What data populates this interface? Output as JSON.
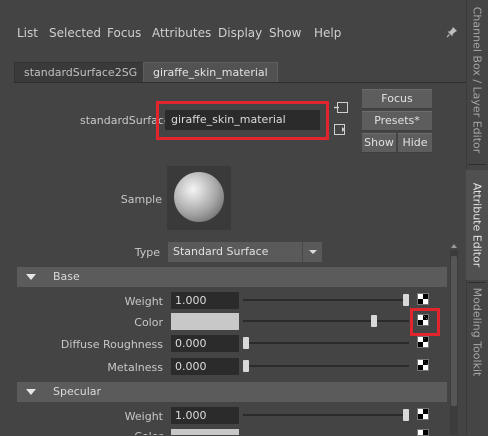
{
  "menu": {
    "items": [
      "List",
      "Selected",
      "Focus",
      "Attributes",
      "Display",
      "Show",
      "Help"
    ]
  },
  "tabs": [
    "standardSurface2SG",
    "giraffe_skin_material"
  ],
  "node": {
    "type_label": "standardSurface:",
    "name": "giraffe_skin_material"
  },
  "buttons": {
    "focus": "Focus",
    "presets": "Presets*",
    "show": "Show",
    "hide": "Hide"
  },
  "sample_label": "Sample",
  "type": {
    "label": "Type",
    "value": "Standard Surface"
  },
  "sections": {
    "base": {
      "title": "Base",
      "weight": {
        "label": "Weight",
        "value": "1.000",
        "slider": 1.0
      },
      "color": {
        "label": "Color",
        "swatch": "#c8c8c8",
        "slider": 0.8
      },
      "diffuse_roughness": {
        "label": "Diffuse Roughness",
        "value": "0.000",
        "slider": 0.0
      },
      "metalness": {
        "label": "Metalness",
        "value": "0.000",
        "slider": 0.0
      }
    },
    "specular": {
      "title": "Specular",
      "weight": {
        "label": "Weight",
        "value": "1.000",
        "slider": 1.0
      },
      "color": {
        "label": "Color"
      }
    }
  },
  "side_tabs": [
    "Channel Box / Layer Editor",
    "Attribute Editor",
    "Modeling Toolkit"
  ],
  "colors": {
    "highlight": "#e2252c",
    "panel": "#444444",
    "field": "#2b2b2b"
  },
  "icons": [
    "pin-icon",
    "input-connection-icon",
    "output-connection-icon",
    "map-texture-icon",
    "dropdown-arrow-icon",
    "collapse-arrow-icon"
  ]
}
